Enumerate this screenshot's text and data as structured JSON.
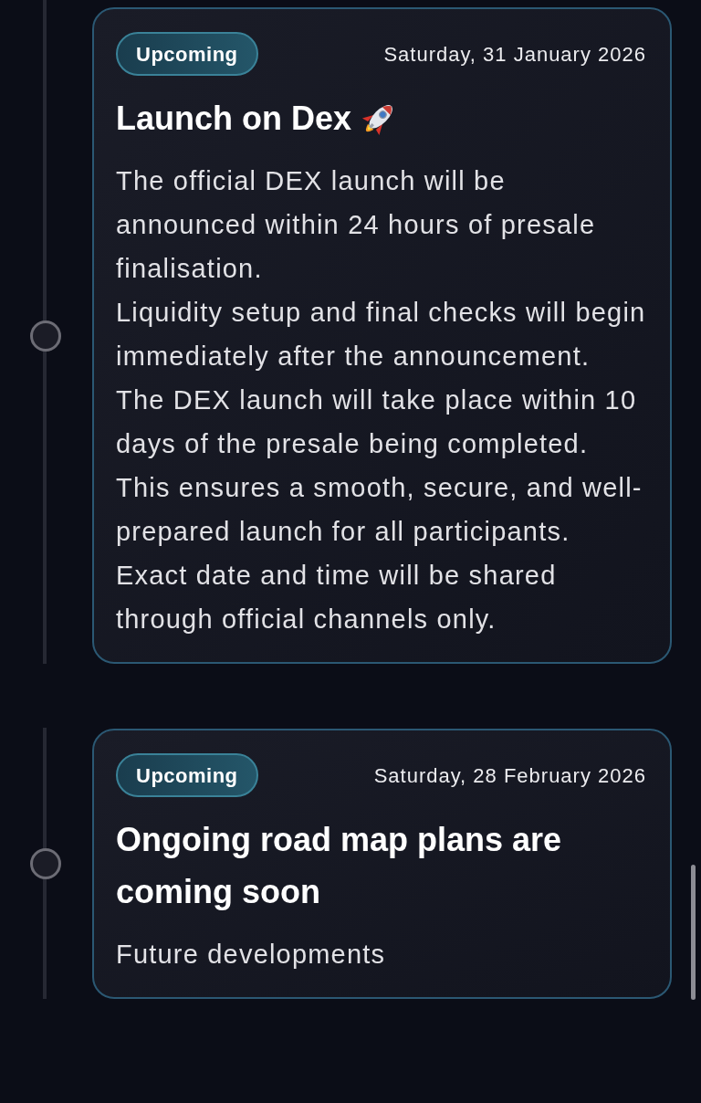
{
  "timeline": [
    {
      "status": "Upcoming",
      "date": "Saturday, 31 January 2026",
      "title": "Launch on Dex",
      "title_icon": true,
      "paragraphs": [
        "The official DEX launch will be announced within 24 hours of presale finalisation.",
        "Liquidity setup and final checks will begin immediately after the announcement.",
        "The DEX launch will take place within 10 days of the presale being completed.",
        "This ensures a smooth, secure, and well-prepared launch for all participants.",
        "Exact date and time will be shared through official channels only."
      ]
    },
    {
      "status": "Upcoming",
      "date": "Saturday, 28 February 2026",
      "title": "Ongoing road map plans are coming soon",
      "title_icon": false,
      "paragraphs": [
        "Future developments"
      ]
    }
  ]
}
